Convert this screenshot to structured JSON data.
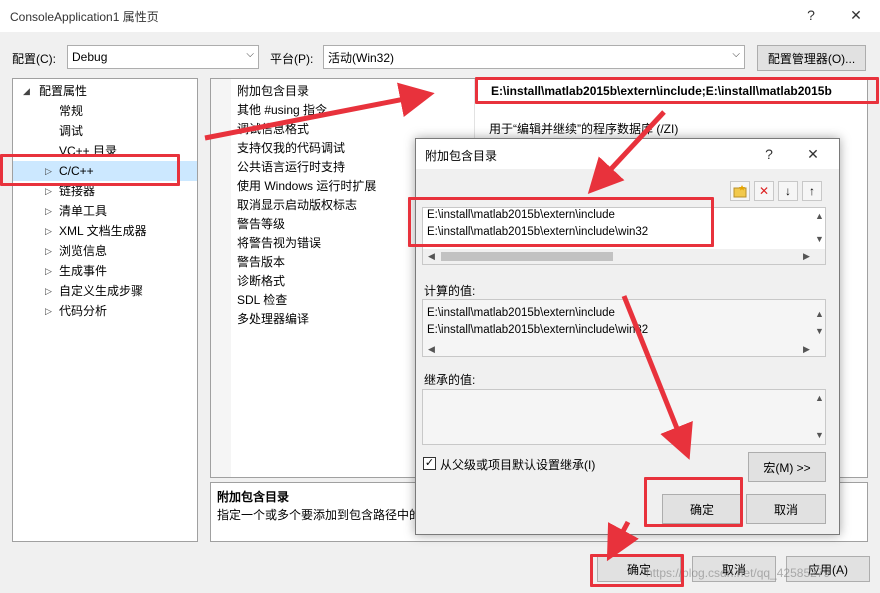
{
  "window": {
    "title": "ConsoleApplication1 属性页",
    "help_glyph": "?",
    "close_glyph": "✕"
  },
  "toolbar": {
    "config_label": "配置(C):",
    "config_value": "Debug",
    "platform_label": "平台(P):",
    "platform_value": "活动(Win32)",
    "config_manager_label": "配置管理器(O)..."
  },
  "tree": {
    "root": "配置属性",
    "items": [
      "常规",
      "调试",
      "VC++ 目录",
      "C/C++",
      "链接器",
      "清单工具",
      "XML 文档生成器",
      "浏览信息",
      "生成事件",
      "自定义生成步骤",
      "代码分析"
    ]
  },
  "grid": {
    "rows": [
      {
        "name": "附加包含目录",
        "value": "E:\\install\\matlab2015b\\extern\\include;E:\\install\\matlab2015b"
      },
      {
        "name": "其他 #using 指令",
        "value": ""
      },
      {
        "name": "调试信息格式",
        "value": "用于“编辑并继续”的程序数据库 (/ZI)"
      },
      {
        "name": "支持仅我的代码调试",
        "value": ""
      },
      {
        "name": "公共语言运行时支持",
        "value": ""
      },
      {
        "name": "使用 Windows 运行时扩展",
        "value": ""
      },
      {
        "name": "取消显示启动版权标志",
        "value": ""
      },
      {
        "name": "警告等级",
        "value": ""
      },
      {
        "name": "将警告视为错误",
        "value": ""
      },
      {
        "name": "警告版本",
        "value": ""
      },
      {
        "name": "诊断格式",
        "value": ""
      },
      {
        "name": "SDL 检查",
        "value": ""
      },
      {
        "name": "多处理器编译",
        "value": ""
      }
    ]
  },
  "description": {
    "title": "附加包含目录",
    "text": "指定一个或多个要添加到包含路径中的"
  },
  "dialog": {
    "title": "附加包含目录",
    "help_glyph": "?",
    "close_glyph": "✕",
    "entries": [
      "E:\\install\\matlab2015b\\extern\\include",
      "E:\\install\\matlab2015b\\extern\\include\\win32"
    ],
    "computed_label": "计算的值:",
    "computed": [
      "E:\\install\\matlab2015b\\extern\\include",
      "E:\\install\\matlab2015b\\extern\\include\\win32"
    ],
    "inherited_label": "继承的值:",
    "inherit_checkbox_label": "从父级或项目默认设置继承(I)",
    "macro_button": "宏(M) >>",
    "ok": "确定",
    "cancel": "取消"
  },
  "footer": {
    "ok": "确定",
    "cancel": "取消",
    "apply": "应用(A)"
  },
  "watermark": "https://blog.csdn.net/qq_42585279",
  "colors": {
    "annotation_red": "#e8323c",
    "selection": "#cce8ff"
  }
}
